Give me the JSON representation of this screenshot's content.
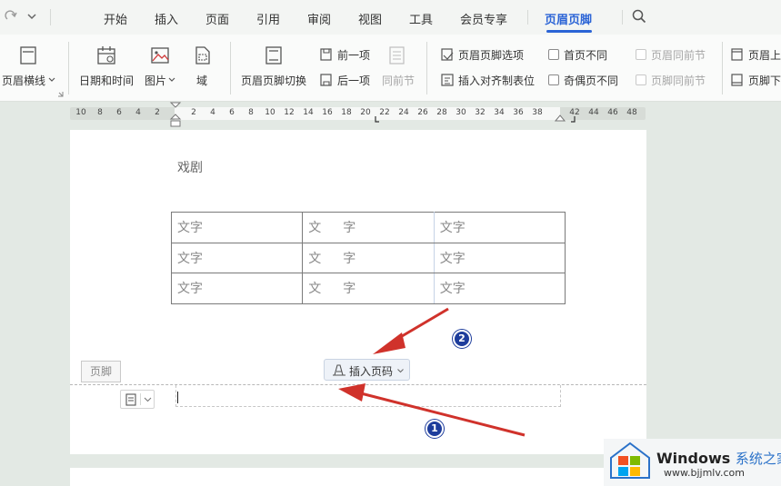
{
  "tabs": [
    "开始",
    "插入",
    "页面",
    "引用",
    "审阅",
    "视图",
    "工具",
    "会员专享",
    "页眉页脚"
  ],
  "active_tab": "页眉页脚",
  "ribbon": {
    "header_line": "页眉横线",
    "date_time": "日期和时间",
    "picture": "图片",
    "field": "域",
    "switch_header_footer": "页眉页脚切换",
    "previous": "前一项",
    "next": "后一项",
    "same_as_previous_section": "同前节",
    "header_footer_options": "页眉页脚选项",
    "insert_align_tab": "插入对齐制表位",
    "different_first_page": "首页不同",
    "different_odd_even": "奇偶页不同",
    "header_same_as_prev": "页眉同前节",
    "footer_same_as_prev": "页脚同前节",
    "header_top": "页眉上",
    "footer_bottom": "页脚下"
  },
  "ruler_numbers": [
    "10",
    "8",
    "6",
    "4",
    "2",
    "2",
    "4",
    "6",
    "8",
    "10",
    "12",
    "14",
    "16",
    "18",
    "20",
    "22",
    "24",
    "26",
    "28",
    "30",
    "32",
    "34",
    "36",
    "38",
    "42",
    "44",
    "46",
    "48"
  ],
  "document": {
    "title": "戏剧",
    "table": [
      [
        "文字",
        [
          "文",
          "字"
        ],
        "文字"
      ],
      [
        "文字",
        [
          "文",
          "字"
        ],
        "文字"
      ],
      [
        "文字",
        [
          "文",
          "字"
        ],
        "文字"
      ]
    ]
  },
  "footer": {
    "tag": "页脚",
    "insert_page_number": "插入页码"
  },
  "annotations": {
    "badge_1": "1",
    "badge_2": "2",
    "arrow_color": "#d0322b"
  },
  "watermark": {
    "brand": "Windows",
    "site_name": "系统之家",
    "url": "www.bjjmlv.com"
  }
}
